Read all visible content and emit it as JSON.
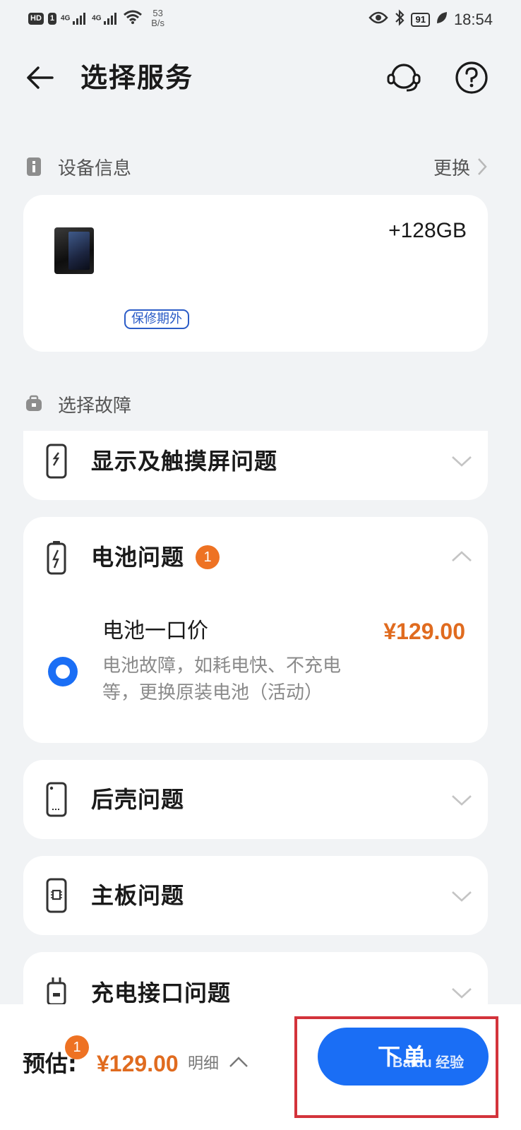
{
  "status_bar": {
    "hd": "HD",
    "sim": "1",
    "net1": "4G",
    "net2": "4G",
    "speed_value": "53",
    "speed_unit": "B/s",
    "battery": "91",
    "time": "18:54"
  },
  "header": {
    "title": "选择服务"
  },
  "device_section": {
    "label": "设备信息",
    "change_label": "更换",
    "spec": "+128GB",
    "warranty": "保修期外"
  },
  "fault_section": {
    "label": "选择故障",
    "categories": [
      {
        "label": "显示及触摸屏问题",
        "icon": "screen-icon",
        "expanded": false
      },
      {
        "label": "电池问题",
        "icon": "battery-icon",
        "expanded": true,
        "badge": "1",
        "option": {
          "title": "电池一口价",
          "price": "¥129.00",
          "desc_line1": "电池故障，如耗电快、不充电",
          "desc_line2": "等，更换原装电池（活动）",
          "selected": true
        }
      },
      {
        "label": "后壳问题",
        "icon": "back-cover-icon",
        "expanded": false
      },
      {
        "label": "主板问题",
        "icon": "mainboard-icon",
        "expanded": false
      },
      {
        "label": "充电接口问题",
        "icon": "charging-port-icon",
        "expanded": false
      }
    ]
  },
  "bottom_bar": {
    "estimate_label": "预估:",
    "badge": "1",
    "price": "¥129.00",
    "detail_label": "明细",
    "order_label": "下单",
    "watermark": "Baidu 经验"
  },
  "colors": {
    "accent_blue": "#1a6ef5",
    "price_orange": "#e06b1f",
    "badge_orange": "#ee7223",
    "highlight_red": "#d3333b"
  }
}
